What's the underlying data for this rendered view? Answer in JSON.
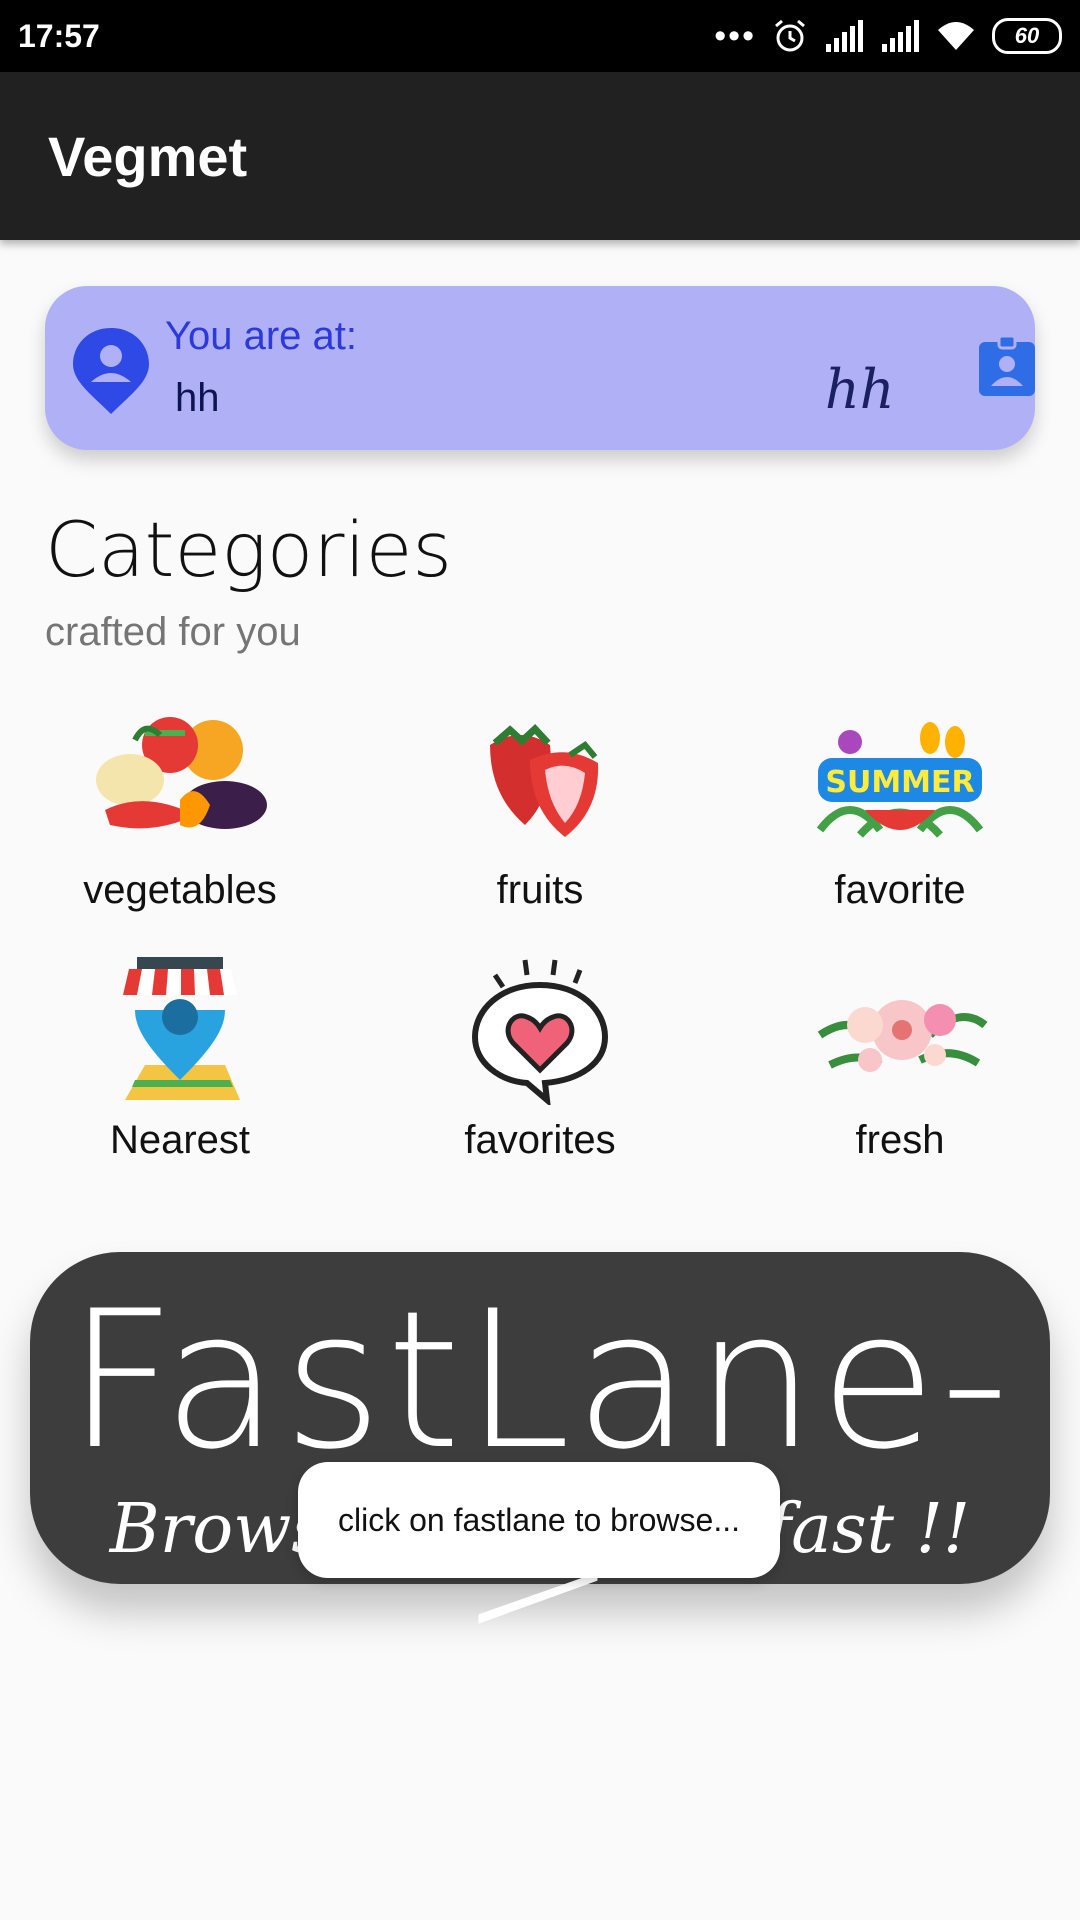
{
  "status_bar": {
    "time": "17:57",
    "dots": "•••",
    "battery": "60",
    "icons": [
      "alarm-icon",
      "signal-icon",
      "signal-icon",
      "wifi-icon",
      "battery-icon"
    ]
  },
  "app_bar": {
    "title": "Vegmet"
  },
  "location": {
    "label": "You are at:",
    "value": "hh",
    "signature": "hh",
    "pin_icon": "location-pin-icon",
    "button_icon": "contact-badge-icon",
    "colors": {
      "card": "#b0b0f7",
      "accent": "#2c3ad8"
    }
  },
  "categories": {
    "title": "Categories",
    "subtitle": "crafted for you",
    "items": [
      {
        "label": "vegetables",
        "image": "vegetables-image"
      },
      {
        "label": "fruits",
        "image": "strawberries-image"
      },
      {
        "label": "favorite",
        "image": "summer-image"
      },
      {
        "label": "Nearest",
        "image": "store-location-image"
      },
      {
        "label": "favorites",
        "image": "heart-bubble-image"
      },
      {
        "label": "fresh",
        "image": "flowers-image"
      }
    ]
  },
  "fastlane": {
    "title": "FastLane->",
    "subtitle": "Browse best items fast !!"
  },
  "toast": {
    "text": "click on fastlane to browse..."
  }
}
